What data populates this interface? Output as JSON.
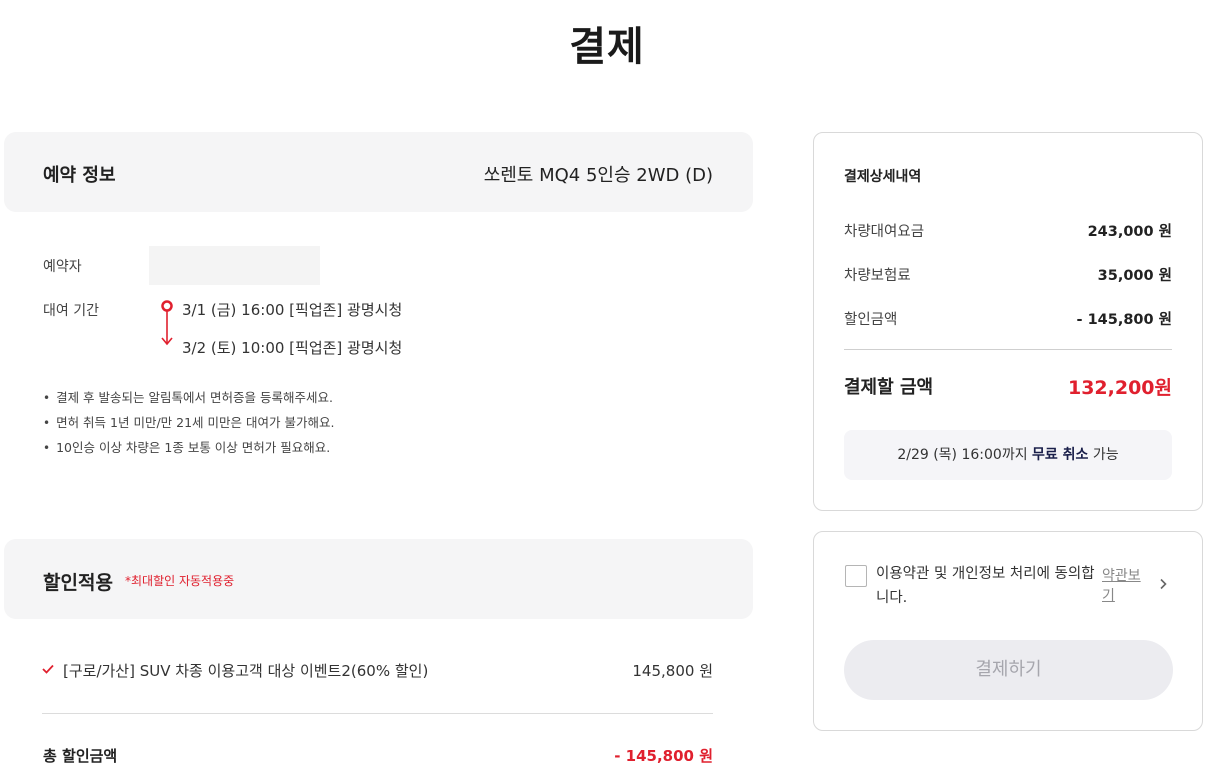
{
  "page": {
    "title": "결제"
  },
  "reservation": {
    "header_label": "예약 정보",
    "car_name": "쏘렌토 MQ4 5인승 2WD (D)",
    "reserver_label": "예약자",
    "period_label": "대여 기간",
    "pickup": "3/1 (금) 16:00 [픽업존] 광명시청",
    "return": "3/2 (토) 10:00 [픽업존] 광명시청",
    "notes": [
      "결제 후 발송되는 알림톡에서 면허증을 등록해주세요.",
      "면허 취득 1년 미만/만 21세 미만은 대여가 불가해요.",
      "10인승 이상 차량은 1종 보통 이상 면허가 필요해요."
    ]
  },
  "discount": {
    "header_label": "할인적용",
    "header_note": "*최대할인 자동적용중",
    "item_name": "[구로/가산] SUV 차종 이용고객 대상 이벤트2(60% 할인)",
    "item_amount": "145,800 원",
    "total_label": "총 할인금액",
    "total_amount": "- 145,800 원"
  },
  "summary": {
    "title": "결제상세내역",
    "rows": [
      {
        "label": "차량대여요금",
        "value": "243,000 원"
      },
      {
        "label": "차량보험료",
        "value": "35,000 원"
      },
      {
        "label": "할인금액",
        "value": "- 145,800 원"
      }
    ],
    "pay_label": "결제할 금액",
    "pay_amount": "132,200원",
    "cancel_prefix": "2/29 (목) 16:00까지 ",
    "cancel_bold": "무료 취소",
    "cancel_suffix": " 가능"
  },
  "agreement": {
    "text": "이용약관 및 개인정보 처리에 동의합니다.",
    "terms_link": "약관보기",
    "pay_button": "결제하기"
  },
  "colors": {
    "accent_red": "#e0202e",
    "navy": "#1a1f4a",
    "disabled_button": "#ececf0"
  }
}
